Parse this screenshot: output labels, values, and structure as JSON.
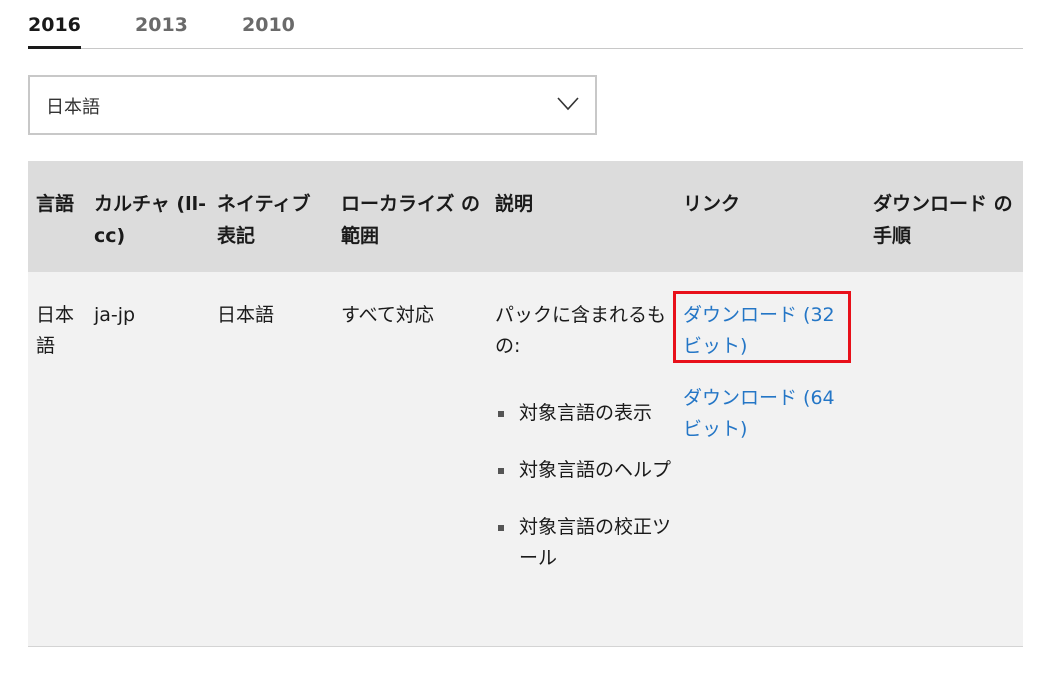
{
  "tabs": [
    {
      "label": "2016",
      "active": true
    },
    {
      "label": "2013",
      "active": false
    },
    {
      "label": "2010",
      "active": false
    }
  ],
  "language_select": {
    "value": "日本語",
    "icon": "chevron-down-icon"
  },
  "table": {
    "headers": {
      "language": "言語",
      "culture": "カルチャ (ll-cc)",
      "native_name": "ネイティブ 表記",
      "localization_scope": "ローカライズ の範囲",
      "description": "説明",
      "links": "リンク",
      "download_steps": "ダウンロード の手順"
    },
    "row": {
      "language": "日本語",
      "culture": "ja-jp",
      "native_name": "日本語",
      "localization_scope": "すべて対応",
      "description_intro": "パックに含まれるもの:",
      "features": [
        "対象言語の表示",
        "対象言語のヘルプ",
        "対象言語の校正ツール"
      ],
      "link_32": "ダウンロード (32 ビット)",
      "link_64": "ダウンロード (64 ビット)",
      "download_steps": ""
    }
  },
  "colors": {
    "link": "#2476c6",
    "highlight": "#e8101a",
    "header_bg": "#dcdcdc",
    "row_bg": "#f2f2f2"
  }
}
